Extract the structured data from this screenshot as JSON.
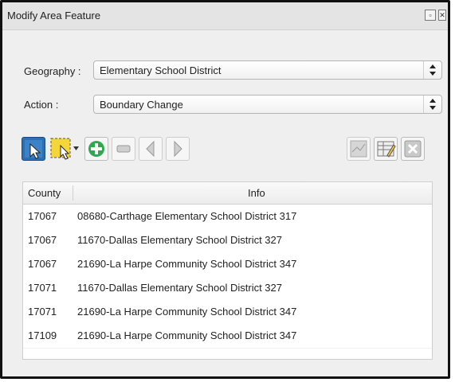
{
  "window": {
    "title": "Modify Area Feature"
  },
  "geography": {
    "label": "Geography :",
    "value": "Elementary School District"
  },
  "action": {
    "label": "Action :",
    "value": "Boundary Change"
  },
  "toolbar": {
    "tools": [
      {
        "name": "select-feature-tool-icon"
      },
      {
        "name": "rectangle-select-tool-icon"
      },
      {
        "name": "add-feature-icon"
      },
      {
        "name": "remove-feature-icon"
      },
      {
        "name": "previous-icon"
      },
      {
        "name": "next-icon"
      },
      {
        "name": "map-view-icon"
      },
      {
        "name": "edit-table-icon"
      },
      {
        "name": "clear-icon"
      }
    ]
  },
  "table": {
    "columns": [
      "County",
      "Info"
    ],
    "rows": [
      {
        "county": "17067",
        "info": "08680-Carthage Elementary School District 317"
      },
      {
        "county": "17067",
        "info": "11670-Dallas Elementary School District 327"
      },
      {
        "county": "17067",
        "info": "21690-La Harpe Community School District 347"
      },
      {
        "county": "17071",
        "info": "11670-Dallas Elementary School District 327"
      },
      {
        "county": "17071",
        "info": "21690-La Harpe Community School District 347"
      },
      {
        "county": "17109",
        "info": "21690-La Harpe Community School District 347"
      }
    ]
  }
}
